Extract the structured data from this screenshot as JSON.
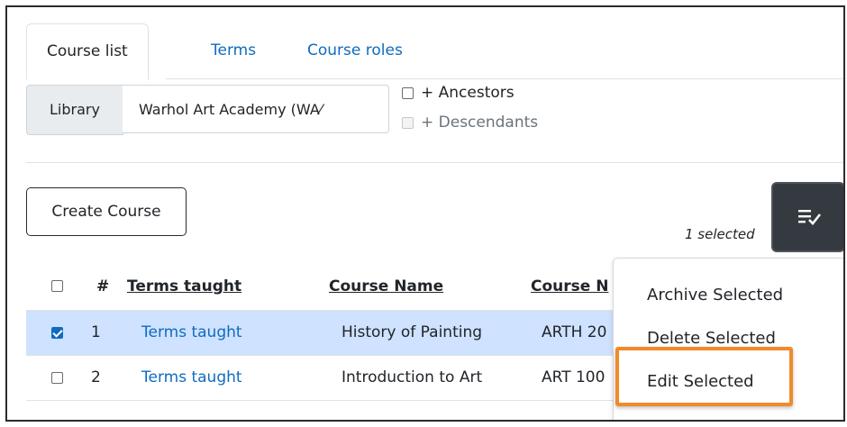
{
  "tabs": [
    {
      "label": "Course list",
      "active": true
    },
    {
      "label": "Terms",
      "active": false
    },
    {
      "label": "Course roles",
      "active": false
    }
  ],
  "filter": {
    "library_label": "Library",
    "library_value": "Warhol Art Academy (WA⁄"
  },
  "options": {
    "ancestors_label": "+ Ancestors",
    "ancestors_checked": false,
    "descendants_label": "+ Descendants",
    "descendants_checked": false
  },
  "toolbar": {
    "create_label": "Create Course",
    "selected_text": "1 selected",
    "bulk_icon": "list-check-icon"
  },
  "table": {
    "headers": {
      "num": "#",
      "terms": "Terms taught",
      "name": "Course Name",
      "code": "Course N"
    },
    "rows": [
      {
        "checked": true,
        "num": "1",
        "terms": "Terms taught",
        "name": "History of Painting",
        "code": "ARTH 20"
      },
      {
        "checked": false,
        "num": "2",
        "terms": "Terms taught",
        "name": "Introduction to Art",
        "code": "ART 100"
      }
    ]
  },
  "dropdown": {
    "items": [
      "Archive Selected",
      "Delete Selected",
      "Edit Selected"
    ],
    "highlighted": "Edit Selected"
  },
  "colors": {
    "link": "#0f6cbf",
    "selected_row": "#cfe2ff",
    "highlight_box": "#f08a2a",
    "bulk_button": "#343a40"
  }
}
